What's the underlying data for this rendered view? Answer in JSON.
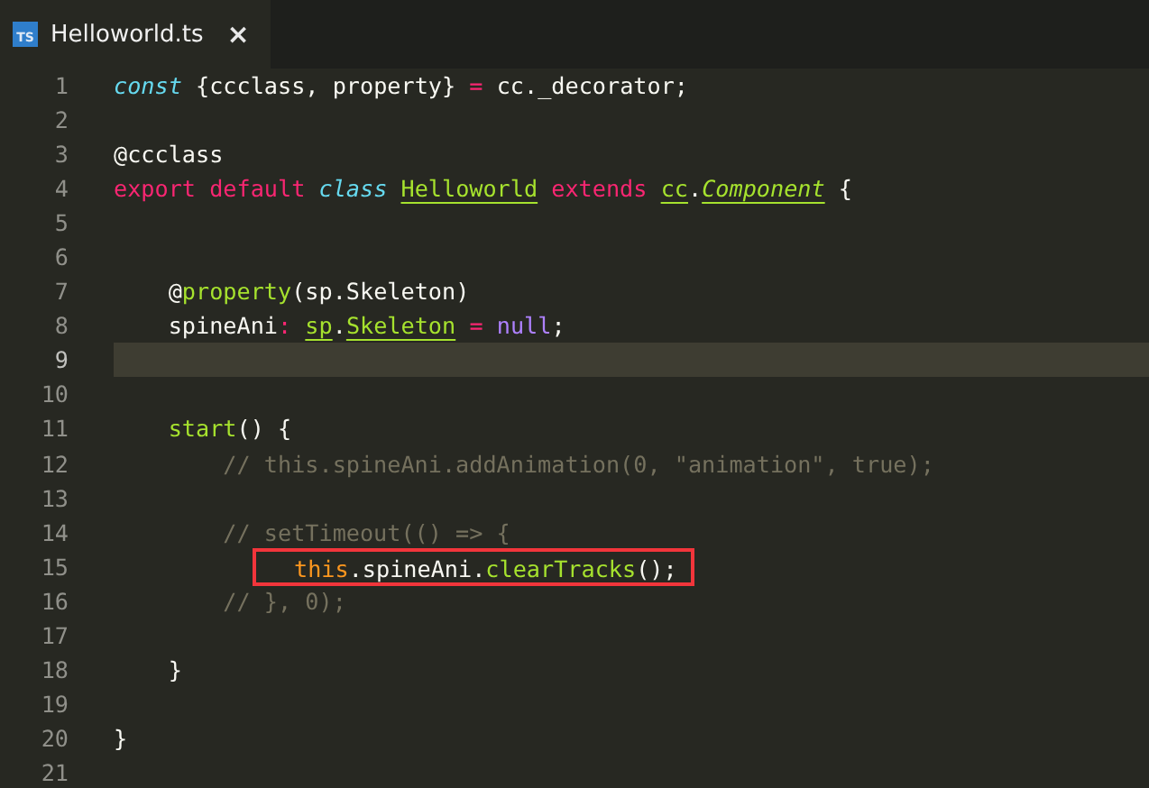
{
  "tabs": [
    {
      "label": "Helloworld.ts",
      "icon_text": "TS",
      "close": "×",
      "selected": true
    }
  ],
  "lines": [
    {
      "number": "1",
      "current": false,
      "boxed": false,
      "tokens": [
        {
          "kind": "storage",
          "text": "const"
        },
        {
          "kind": "plain",
          "text": " {ccclass, property} "
        },
        {
          "kind": "keyword",
          "text": "="
        },
        {
          "kind": "plain",
          "text": " cc._decorator;"
        }
      ]
    },
    {
      "number": "2",
      "current": false
    },
    {
      "number": "3",
      "current": false,
      "boxed": false,
      "tokens": [
        {
          "kind": "plain",
          "text": "@ccclass"
        }
      ]
    },
    {
      "number": "4",
      "current": false,
      "boxed": false,
      "tokens": [
        {
          "kind": "keyword",
          "text": "export default "
        },
        {
          "kind": "storage",
          "text": "class "
        },
        {
          "kind": "type",
          "text": "Helloworld"
        },
        {
          "kind": "keyword",
          "text": " extends "
        },
        {
          "kind": "type",
          "text": "cc"
        },
        {
          "kind": "plain",
          "text": "."
        },
        {
          "kind": "inherited",
          "text": "Component"
        },
        {
          "kind": "plain",
          "text": " {"
        }
      ]
    },
    {
      "number": "5",
      "current": false
    },
    {
      "number": "6",
      "current": false
    },
    {
      "number": "7",
      "current": false,
      "boxed": false,
      "tokens": [
        {
          "kind": "plain",
          "text": "    @"
        },
        {
          "kind": "function",
          "text": "property"
        },
        {
          "kind": "plain",
          "text": "(sp.Skeleton)"
        }
      ]
    },
    {
      "number": "8",
      "current": false,
      "boxed": false,
      "tokens": [
        {
          "kind": "plain",
          "text": "    spineAni"
        },
        {
          "kind": "keyword",
          "text": ": "
        },
        {
          "kind": "type",
          "text": "sp"
        },
        {
          "kind": "plain",
          "text": "."
        },
        {
          "kind": "type",
          "text": "Skeleton"
        },
        {
          "kind": "keyword",
          "text": " = "
        },
        {
          "kind": "constant",
          "text": "null"
        },
        {
          "kind": "plain",
          "text": ";"
        }
      ]
    },
    {
      "number": "9",
      "current": true
    },
    {
      "number": "10",
      "current": false
    },
    {
      "number": "11",
      "current": false,
      "boxed": false,
      "tokens": [
        {
          "kind": "function",
          "text": "    start"
        },
        {
          "kind": "plain",
          "text": "() {"
        }
      ]
    },
    {
      "number": "12",
      "current": false,
      "boxed": false,
      "tokens": [
        {
          "kind": "comment",
          "text": "        // this.spineAni.addAnimation(0, \"animation\", true);"
        }
      ]
    },
    {
      "number": "13",
      "current": false
    },
    {
      "number": "14",
      "current": false,
      "boxed": false,
      "tokens": [
        {
          "kind": "comment",
          "text": "        // setTimeout(() => {"
        }
      ]
    },
    {
      "number": "15",
      "current": false,
      "boxed": true,
      "tokens": [
        {
          "kind": "variable",
          "text": "this"
        },
        {
          "kind": "plain",
          "text": ".spineAni."
        },
        {
          "kind": "function",
          "text": "clearTracks"
        },
        {
          "kind": "plain",
          "text": "();"
        }
      ]
    },
    {
      "number": "16",
      "current": false,
      "boxed": false,
      "tokens": [
        {
          "kind": "comment",
          "text": "        // }, 0);"
        }
      ]
    },
    {
      "number": "17",
      "current": false
    },
    {
      "number": "18",
      "current": false,
      "boxed": false,
      "tokens": [
        {
          "kind": "plain",
          "text": "    }"
        }
      ]
    },
    {
      "number": "19",
      "current": false
    },
    {
      "number": "20",
      "current": false,
      "boxed": false,
      "tokens": [
        {
          "kind": "plain",
          "text": "}"
        }
      ]
    },
    {
      "number": "21",
      "current": false
    }
  ]
}
